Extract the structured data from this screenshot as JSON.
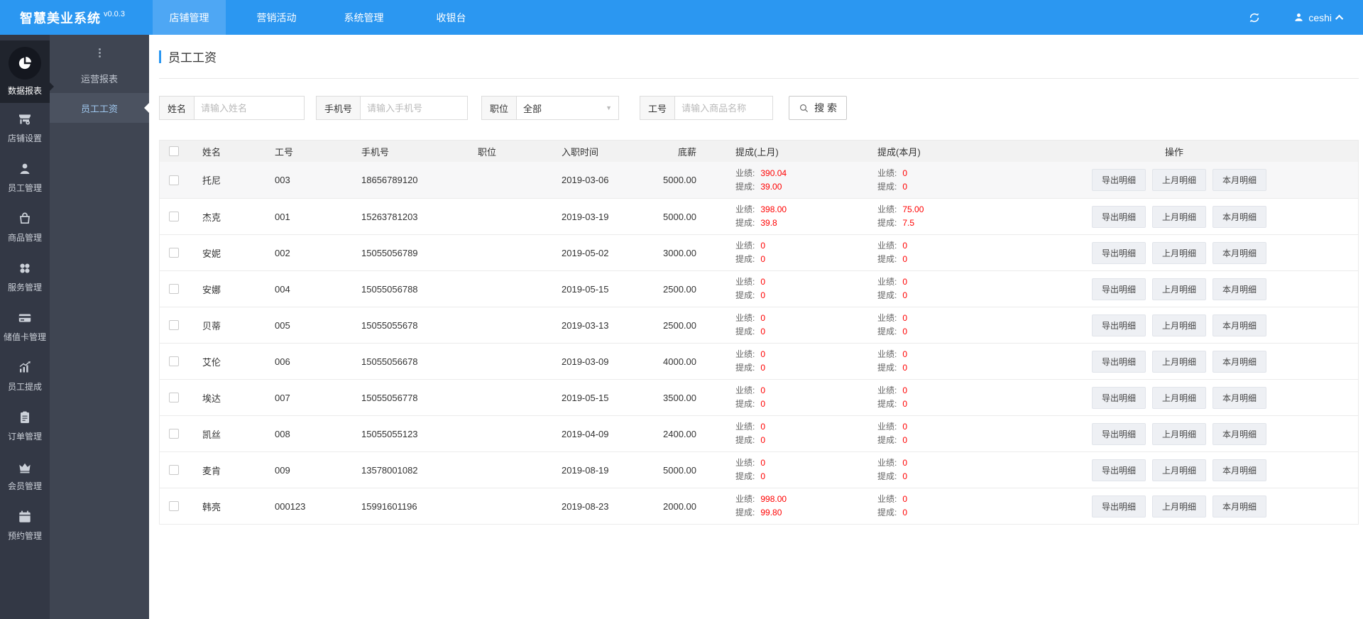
{
  "app": {
    "title": "智慧美业系统",
    "version": "v0.0.3"
  },
  "topbar": {
    "tabs": [
      {
        "label": "店铺管理",
        "active": true
      },
      {
        "label": "营销活动",
        "active": false
      },
      {
        "label": "系统管理",
        "active": false
      },
      {
        "label": "收银台",
        "active": false
      }
    ],
    "user": "ceshi"
  },
  "rail": {
    "items": [
      {
        "label": "数据报表",
        "icon": "pie-chart-icon",
        "active": true
      },
      {
        "label": "店铺设置",
        "icon": "store-icon",
        "active": false
      },
      {
        "label": "员工管理",
        "icon": "staff-icon",
        "active": false
      },
      {
        "label": "商品管理",
        "icon": "goods-bag-icon",
        "active": false
      },
      {
        "label": "服务管理",
        "icon": "services-icon",
        "active": false
      },
      {
        "label": "储值卡管理",
        "icon": "stored-card-icon",
        "active": false
      },
      {
        "label": "员工提成",
        "icon": "commission-chart-icon",
        "active": false
      },
      {
        "label": "订单管理",
        "icon": "orders-icon",
        "active": false
      },
      {
        "label": "会员管理",
        "icon": "members-crown-icon",
        "active": false
      },
      {
        "label": "预约管理",
        "icon": "appointments-calendar-icon",
        "active": false
      }
    ]
  },
  "submenu": {
    "items": [
      {
        "label": "运营报表",
        "active": false
      },
      {
        "label": "员工工资",
        "active": true
      }
    ]
  },
  "page": {
    "title": "员工工资"
  },
  "filters": {
    "name": {
      "label": "姓名",
      "placeholder": "请输入姓名"
    },
    "phone": {
      "label": "手机号",
      "placeholder": "请输入手机号"
    },
    "position": {
      "label": "职位",
      "value": "全部"
    },
    "empno": {
      "label": "工号",
      "placeholder": "请输入商品名称"
    },
    "search_label": "搜 索"
  },
  "table": {
    "columns": [
      "姓名",
      "工号",
      "手机号",
      "职位",
      "入职时间",
      "底薪",
      "提成(上月)",
      "提成(本月)",
      "操作"
    ],
    "perf_label": "业绩:",
    "comm_label": "提成:",
    "action_buttons": [
      "导出明细",
      "上月明细",
      "本月明细"
    ],
    "rows": [
      {
        "name": "托尼",
        "empno": "003",
        "phone": "18656789120",
        "position": "",
        "hire_date": "2019-03-06",
        "base_salary": "5000.00",
        "last": {
          "perf": "390.04",
          "comm": "39.00"
        },
        "cur": {
          "perf": "0",
          "comm": "0"
        }
      },
      {
        "name": "杰克",
        "empno": "001",
        "phone": "15263781203",
        "position": "",
        "hire_date": "2019-03-19",
        "base_salary": "5000.00",
        "last": {
          "perf": "398.00",
          "comm": "39.8"
        },
        "cur": {
          "perf": "75.00",
          "comm": "7.5"
        }
      },
      {
        "name": "安妮",
        "empno": "002",
        "phone": "15055056789",
        "position": "",
        "hire_date": "2019-05-02",
        "base_salary": "3000.00",
        "last": {
          "perf": "0",
          "comm": "0"
        },
        "cur": {
          "perf": "0",
          "comm": "0"
        }
      },
      {
        "name": "安娜",
        "empno": "004",
        "phone": "15055056788",
        "position": "",
        "hire_date": "2019-05-15",
        "base_salary": "2500.00",
        "last": {
          "perf": "0",
          "comm": "0"
        },
        "cur": {
          "perf": "0",
          "comm": "0"
        }
      },
      {
        "name": "贝蒂",
        "empno": "005",
        "phone": "15055055678",
        "position": "",
        "hire_date": "2019-03-13",
        "base_salary": "2500.00",
        "last": {
          "perf": "0",
          "comm": "0"
        },
        "cur": {
          "perf": "0",
          "comm": "0"
        }
      },
      {
        "name": "艾伦",
        "empno": "006",
        "phone": "15055056678",
        "position": "",
        "hire_date": "2019-03-09",
        "base_salary": "4000.00",
        "last": {
          "perf": "0",
          "comm": "0"
        },
        "cur": {
          "perf": "0",
          "comm": "0"
        }
      },
      {
        "name": "埃达",
        "empno": "007",
        "phone": "15055056778",
        "position": "",
        "hire_date": "2019-05-15",
        "base_salary": "3500.00",
        "last": {
          "perf": "0",
          "comm": "0"
        },
        "cur": {
          "perf": "0",
          "comm": "0"
        }
      },
      {
        "name": "凯丝",
        "empno": "008",
        "phone": "15055055123",
        "position": "",
        "hire_date": "2019-04-09",
        "base_salary": "2400.00",
        "last": {
          "perf": "0",
          "comm": "0"
        },
        "cur": {
          "perf": "0",
          "comm": "0"
        }
      },
      {
        "name": "麦肯",
        "empno": "009",
        "phone": "13578001082",
        "position": "",
        "hire_date": "2019-08-19",
        "base_salary": "5000.00",
        "last": {
          "perf": "0",
          "comm": "0"
        },
        "cur": {
          "perf": "0",
          "comm": "0"
        }
      },
      {
        "name": "韩亮",
        "empno": "000123",
        "phone": "15991601196",
        "position": "",
        "hire_date": "2019-08-23",
        "base_salary": "2000.00",
        "last": {
          "perf": "998.00",
          "comm": "99.80"
        },
        "cur": {
          "perf": "0",
          "comm": "0"
        }
      }
    ]
  }
}
